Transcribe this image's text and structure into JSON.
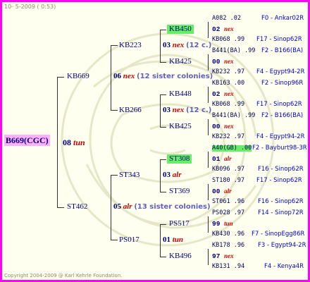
{
  "header": {
    "date": "10- 5-2009 ( 0:53)"
  },
  "footer": {
    "copyright": "Copyright 2004-2009 @ Karl Kehrle Foundation."
  },
  "colors": {
    "frame": "#ff00ff",
    "root_bg": "#ffb0ff",
    "highlight": "#66ee66",
    "background": "#fffff0"
  },
  "root": {
    "name": "B669(CGC)",
    "year": "08",
    "mark": "tun"
  },
  "gen1": [
    {
      "name": "KB669",
      "year": "06",
      "mark": "nex",
      "note": "(12 sister colonies)"
    },
    {
      "name": "ST462",
      "year": "05",
      "mark": "alr",
      "note": "(13 sister colonies)"
    }
  ],
  "gen2": [
    {
      "name": "KB223",
      "year": "03",
      "mark": "nex",
      "note": "(12 c.)"
    },
    {
      "name": "KB266",
      "year": "03",
      "mark": "nex",
      "note": "(12 c.)"
    },
    {
      "name": "ST343",
      "year": "03",
      "mark": "alr",
      "note": ""
    },
    {
      "name": "PS017",
      "year": "01",
      "mark": "tun",
      "note": ""
    }
  ],
  "gen3": [
    {
      "name": "KB450"
    },
    {
      "name": "KB425"
    },
    {
      "name": "KB448"
    },
    {
      "name": "KB425"
    },
    {
      "name": "ST308"
    },
    {
      "name": "ST369"
    },
    {
      "name": "PS517"
    },
    {
      "name": "KB496"
    }
  ],
  "gen4": [
    {
      "top": "A082 .02",
      "top_loc": "F0 - Ankar02R",
      "year": "02",
      "mark": "nex",
      "bottom": "KB068 .99",
      "bottom_loc": "F17 - Sinop62R"
    },
    {
      "top": "B441(BA) .99",
      "top_loc": "F2 - B166(BA)",
      "year": "00",
      "mark": "nex",
      "bottom": "KB232 .97",
      "bottom_loc": "F4 - Egypt94-2R"
    },
    {
      "top": "KB163 .00",
      "top_loc": "F2 - Sinop96R",
      "year": "02",
      "mark": "nex",
      "bottom": "KB068 .99",
      "bottom_loc": "F17 - Sinop62R"
    },
    {
      "top": "B441(BA) .99",
      "top_loc": "F2 - B166(BA)",
      "year": "00",
      "mark": "nex",
      "bottom": "KB232 .97",
      "bottom_loc": "F4 - Egypt94-2R"
    },
    {
      "top": "A40(GB) .00",
      "top_loc": "F2 - Bayburt98-3R",
      "year": "01",
      "mark": "alr",
      "bottom": "KB096 .97",
      "bottom_loc": "F16 - Sinop62R"
    },
    {
      "top": "ST180 .97",
      "top_loc": "F17 - Sinop62R",
      "year": "00",
      "mark": "alr",
      "bottom": "ST061 .96",
      "bottom_loc": "F16 - Sinop62R"
    },
    {
      "top": "PS028 .97",
      "top_loc": "F14 - Sinop72R",
      "year": "99",
      "mark": "tun",
      "bottom": "KB430 .96",
      "bottom_loc": "F7 - SinopEgg86R"
    },
    {
      "top": "KB178 .96",
      "top_loc": "F3 - Egypt94-2R",
      "year": "97",
      "mark": "nex",
      "bottom": "KB131 .94",
      "bottom_loc": "F4 - Kenya4R"
    }
  ]
}
